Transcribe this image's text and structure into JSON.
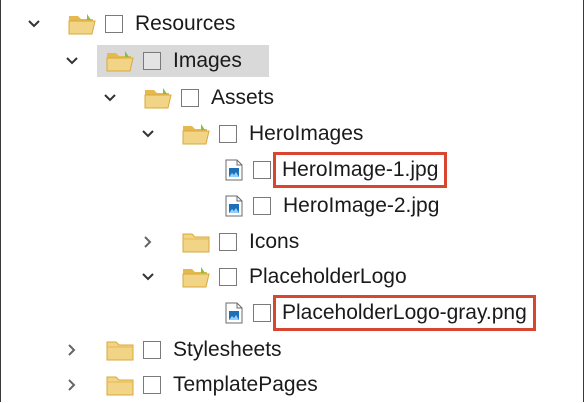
{
  "tree": {
    "nodes": [
      {
        "id": "resources",
        "label": "Resources",
        "type": "folder",
        "expanded": true
      },
      {
        "id": "images",
        "label": "Images",
        "type": "folder",
        "expanded": true,
        "selected": true
      },
      {
        "id": "assets",
        "label": "Assets",
        "type": "folder",
        "expanded": true
      },
      {
        "id": "heroimages",
        "label": "HeroImages",
        "type": "folder",
        "expanded": true
      },
      {
        "id": "heroimage1",
        "label": "HeroImage-1.jpg",
        "type": "file",
        "highlighted": true
      },
      {
        "id": "heroimage2",
        "label": "HeroImage-2.jpg",
        "type": "file"
      },
      {
        "id": "icons",
        "label": "Icons",
        "type": "folder",
        "expanded": false
      },
      {
        "id": "placeholderlogo",
        "label": "PlaceholderLogo",
        "type": "folder",
        "expanded": true
      },
      {
        "id": "placeholderlogo-gray",
        "label": "PlaceholderLogo-gray.png",
        "type": "file",
        "highlighted": true
      },
      {
        "id": "stylesheets",
        "label": "Stylesheets",
        "type": "folder",
        "expanded": false
      },
      {
        "id": "templatepages",
        "label": "TemplatePages",
        "type": "folder",
        "expanded": false
      }
    ]
  },
  "colors": {
    "folder_fill": "#f2d486",
    "folder_back": "#e6b94f",
    "selection": "#d9d9d9",
    "callout_outline": "#d9462f",
    "file_image": "#1f6fb8"
  },
  "icons": {
    "expanded": "chevron-down-icon",
    "collapsed": "chevron-right-icon",
    "folder": "folder-icon",
    "file": "image-file-icon"
  }
}
